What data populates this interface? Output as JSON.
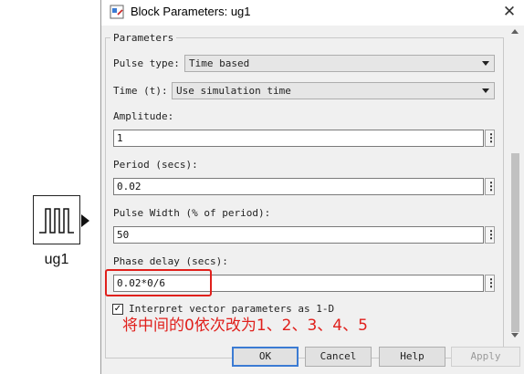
{
  "canvas": {
    "block_label": "ug1",
    "block_icon": "pulse-waveform-icon"
  },
  "dialog": {
    "title": "Block Parameters: ug1",
    "close": "✕",
    "group_title": "Parameters",
    "pulse_type": {
      "label": "Pulse type:",
      "value": "Time based"
    },
    "time": {
      "label": "Time (t):",
      "value": "Use simulation time"
    },
    "amplitude": {
      "label": "Amplitude:",
      "value": "1"
    },
    "period": {
      "label": "Period (secs):",
      "value": "0.02"
    },
    "pulse_width": {
      "label": "Pulse Width (% of period):",
      "value": "50"
    },
    "phase_delay": {
      "label": "Phase delay (secs):",
      "value": "0.02*0/6"
    },
    "interpret_vector": {
      "label": "Interpret vector parameters as 1-D",
      "checked": true,
      "mark": "✓"
    },
    "kebab_glyph": "⋮",
    "annotation": "将中间的0依次改为1、2、3、4、5",
    "buttons": {
      "ok": "OK",
      "cancel": "Cancel",
      "help": "Help",
      "apply": "Apply"
    }
  },
  "colors": {
    "annotation": "#e0201c",
    "primary_border": "#3b7bd3"
  }
}
